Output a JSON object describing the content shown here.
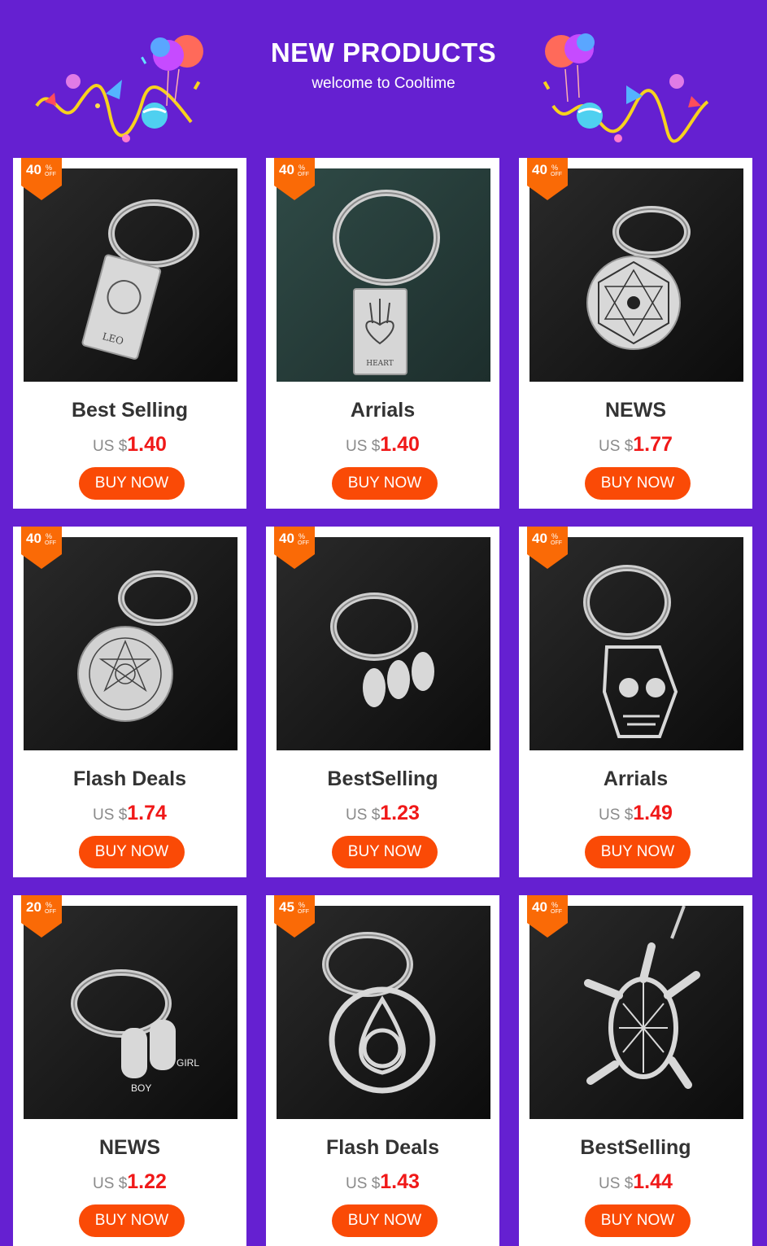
{
  "header": {
    "title": "NEW PRODUCTS",
    "subtitle": "welcome to Cooltime"
  },
  "colors": {
    "background": "#6520d1",
    "badge": "#fa6a06",
    "button": "#fa4a06",
    "price": "#f01818"
  },
  "badge_symbol": "%",
  "badge_off": "OFF",
  "currency": "US $",
  "products": [
    {
      "badge": "40",
      "name": "Best Selling",
      "price": "1.40",
      "button": "BUY NOW",
      "image": "leo-tarot-keychain"
    },
    {
      "badge": "40",
      "name": "Arrials",
      "price": "1.40",
      "button": "BUY NOW",
      "image": "heart-tarot-keychain"
    },
    {
      "badge": "40",
      "name": "NEWS",
      "price": "1.77",
      "button": "BUY NOW",
      "image": "metatron-cube-keychain"
    },
    {
      "badge": "40",
      "name": "Flash Deals",
      "price": "1.74",
      "button": "BUY NOW",
      "image": "seal-amulet-keychain"
    },
    {
      "badge": "40",
      "name": "BestSelling",
      "price": "1.23",
      "button": "BUY NOW",
      "image": "baby-feet-keychain"
    },
    {
      "badge": "40",
      "name": "Arrials",
      "price": "1.49",
      "button": "BUY NOW",
      "image": "skull-keychain"
    },
    {
      "badge": "20",
      "name": "NEWS",
      "price": "1.22",
      "button": "BUY NOW",
      "image": "boy-girl-keychain",
      "image_text": [
        "GIRL",
        "BOY"
      ]
    },
    {
      "badge": "45",
      "name": "Flash Deals",
      "price": "1.43",
      "button": "BUY NOW",
      "image": "celtic-knot-keychain"
    },
    {
      "badge": "40",
      "name": "BestSelling",
      "price": "1.44",
      "button": "BUY NOW",
      "image": "turtle-keychain"
    }
  ]
}
